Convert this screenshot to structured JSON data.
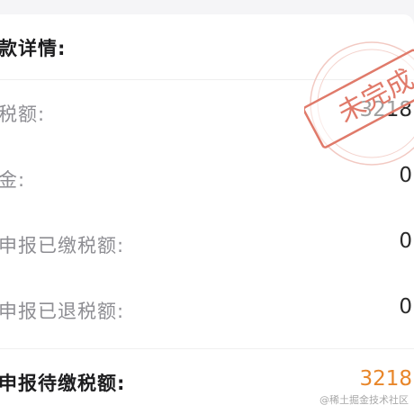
{
  "detail": {
    "title": "款详情:",
    "rows": [
      {
        "label": "税额:",
        "value": "3218"
      },
      {
        "label": "金:",
        "value": "0"
      },
      {
        "label": "申报已缴税额:",
        "value": "0"
      },
      {
        "label": "申报已退税额:",
        "value": "0"
      }
    ],
    "total": {
      "label": "申报待缴税额:",
      "value": "3218"
    }
  },
  "stamp": {
    "text": "未完成",
    "color": "#e07a6a"
  },
  "watermark": "@稀土掘金技术社区",
  "colors": {
    "accent": "#e8862a",
    "label": "#8e8e93",
    "title": "#1d1d1f"
  }
}
